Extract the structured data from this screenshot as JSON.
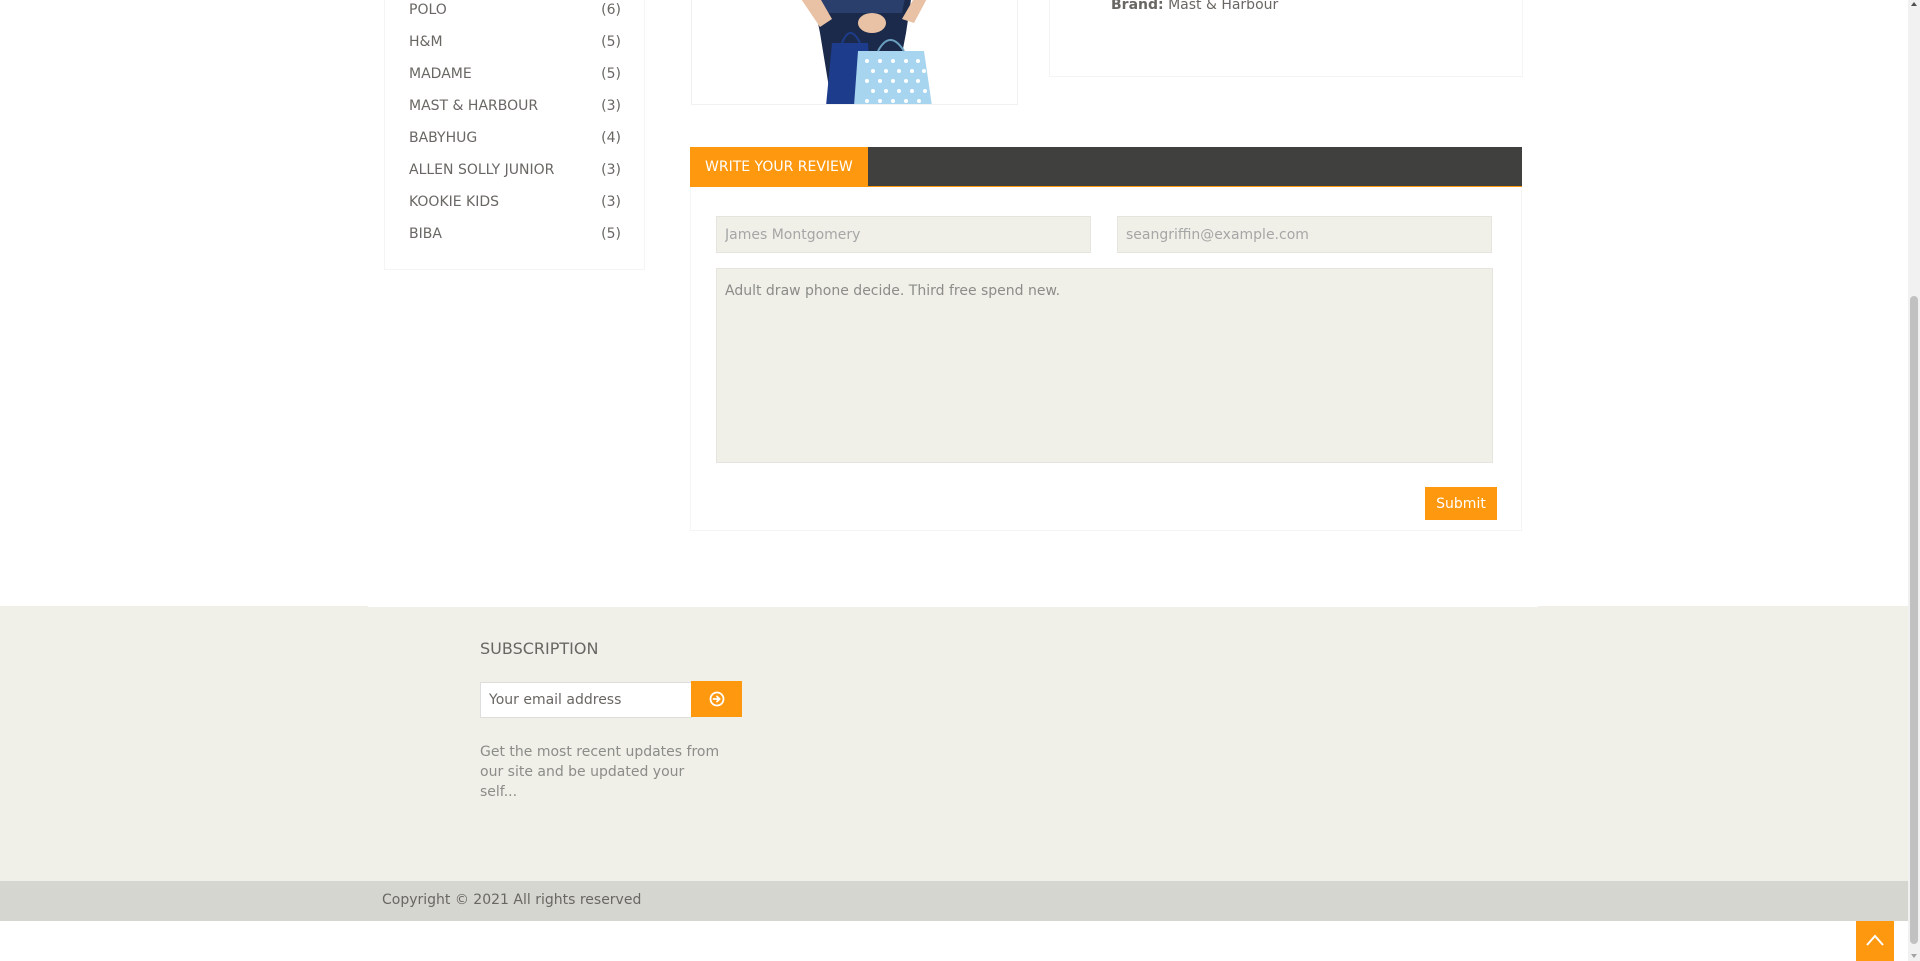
{
  "brands": [
    {
      "name": "POLO",
      "count": "(6)"
    },
    {
      "name": "H&M",
      "count": "(5)"
    },
    {
      "name": "MADAME",
      "count": "(5)"
    },
    {
      "name": "MAST & HARBOUR",
      "count": "(3)"
    },
    {
      "name": "BABYHUG",
      "count": "(4)"
    },
    {
      "name": "ALLEN SOLLY JUNIOR",
      "count": "(3)"
    },
    {
      "name": "KOOKIE KIDS",
      "count": "(3)"
    },
    {
      "name": "BIBA",
      "count": "(5)"
    }
  ],
  "product": {
    "brand_label": "Brand:",
    "brand_value": "Mast & Harbour"
  },
  "review": {
    "tab_label": "WRITE YOUR REVIEW",
    "name_value": "James Montgomery",
    "email_value": "seangriffin@example.com",
    "text_value": "Adult draw phone decide. Third free spend new.",
    "submit_label": "Submit"
  },
  "subscription": {
    "title": "SUBSCRIPTION",
    "email_placeholder": "Your email address",
    "description": "Get the most recent updates from our site and be updated your self..."
  },
  "footer": {
    "copyright": "Copyright © 2021 All rights reserved"
  },
  "colors": {
    "accent": "#fe980f",
    "tab_bar": "#40403e",
    "footer_bg": "#f0f0e9",
    "footer_bottom": "#d6d6d0"
  }
}
